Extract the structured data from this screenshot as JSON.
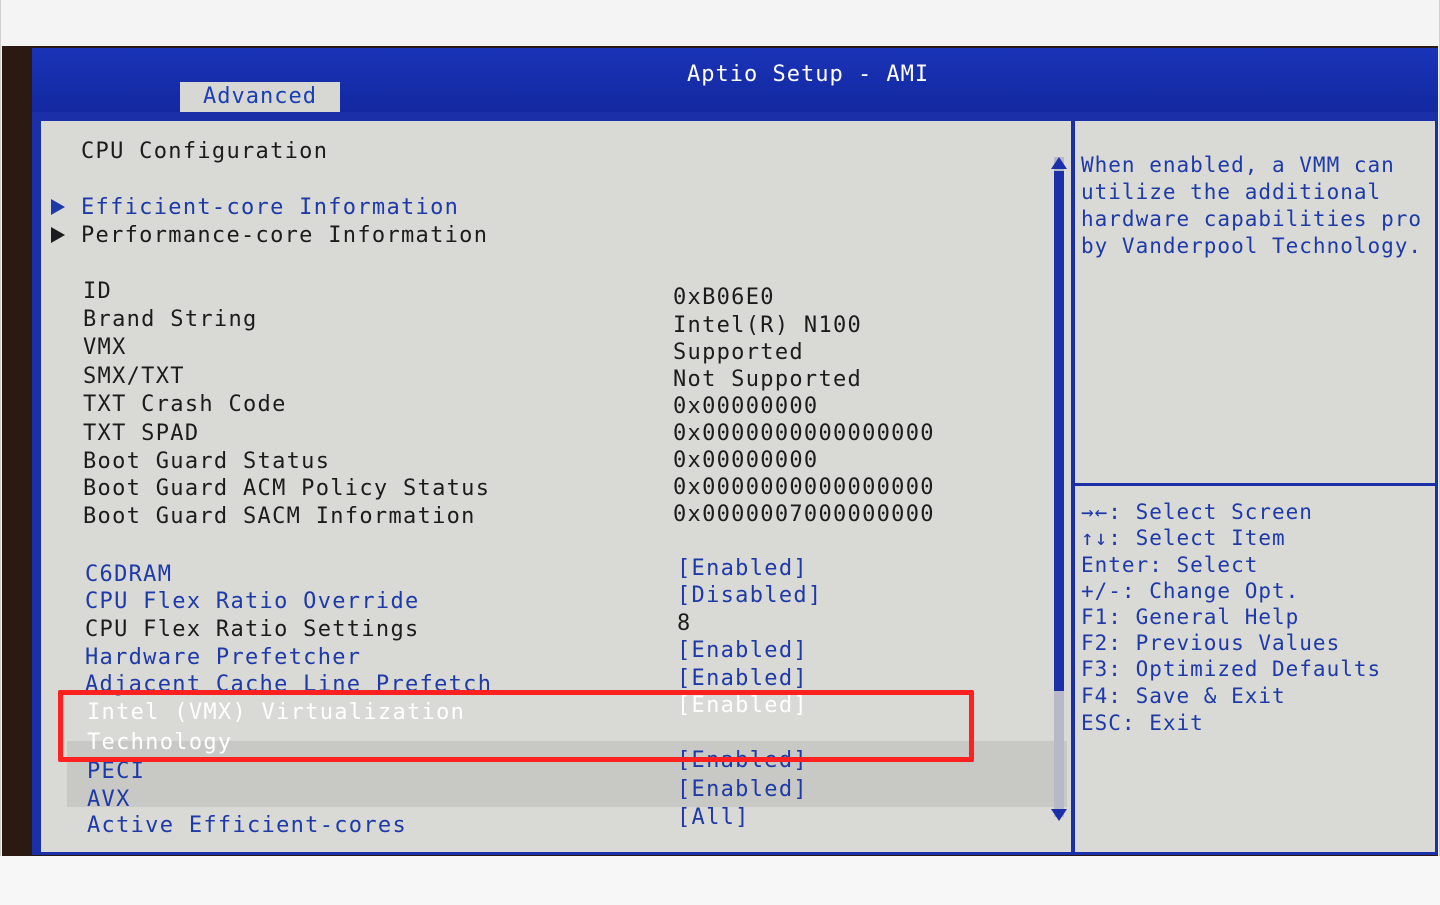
{
  "header": {
    "title": "Aptio Setup - AMI",
    "active_tab": "Advanced"
  },
  "main": {
    "section_title": "CPU Configuration",
    "submenus": [
      {
        "label": "Efficient-core Information",
        "selected": true
      },
      {
        "label": "Performance-core Information",
        "selected": false
      }
    ],
    "info_rows": [
      {
        "label": "ID",
        "value": "0xB06E0"
      },
      {
        "label": "Brand String",
        "value": "Intel(R) N100"
      },
      {
        "label": "VMX",
        "value": "Supported"
      },
      {
        "label": "SMX/TXT",
        "value": "Not Supported"
      },
      {
        "label": "TXT Crash Code",
        "value": "0x00000000"
      },
      {
        "label": "TXT SPAD",
        "value": "0x0000000000000000"
      },
      {
        "label": "Boot Guard Status",
        "value": "0x00000000"
      },
      {
        "label": "Boot Guard ACM Policy Status",
        "value": "0x0000000000000000"
      },
      {
        "label": "Boot Guard SACM Information",
        "value": "0x0000007000000000"
      }
    ],
    "options": [
      {
        "label": "C6DRAM",
        "value": "[Enabled]",
        "configurable": true
      },
      {
        "label": "CPU Flex Ratio Override",
        "value": "[Disabled]",
        "configurable": true
      },
      {
        "label": "CPU Flex Ratio Settings",
        "value": "8",
        "configurable": false
      },
      {
        "label": "Hardware Prefetcher",
        "value": "[Enabled]",
        "configurable": true
      },
      {
        "label": "Adjacent Cache Line Prefetch",
        "value": "[Enabled]",
        "configurable": true
      },
      {
        "label": "Intel (VMX) Virtualization",
        "label2": "Technology",
        "value": "[Enabled]",
        "configurable": true,
        "highlighted": true
      },
      {
        "label": "PECI",
        "value": "[Enabled]",
        "configurable": true
      },
      {
        "label": "AVX",
        "value": "[Enabled]",
        "configurable": true
      },
      {
        "label": "Active Efficient-cores",
        "value": "[All]",
        "configurable": true
      }
    ]
  },
  "help": {
    "lines": [
      "When enabled, a VMM can",
      "utilize the additional",
      "hardware capabilities pro",
      "by Vanderpool Technology."
    ],
    "keys": [
      "→←: Select Screen",
      "↑↓: Select Item",
      "Enter: Select",
      "+/-: Change Opt.",
      "F1: General Help",
      "F2: Previous Values",
      "F3: Optimized Defaults",
      "F4: Save & Exit",
      "ESC: Exit"
    ]
  },
  "colors": {
    "bios_blue": "#1a2fa8",
    "panel_gray": "#d9d9d6",
    "annotation_red": "#ff2020"
  }
}
